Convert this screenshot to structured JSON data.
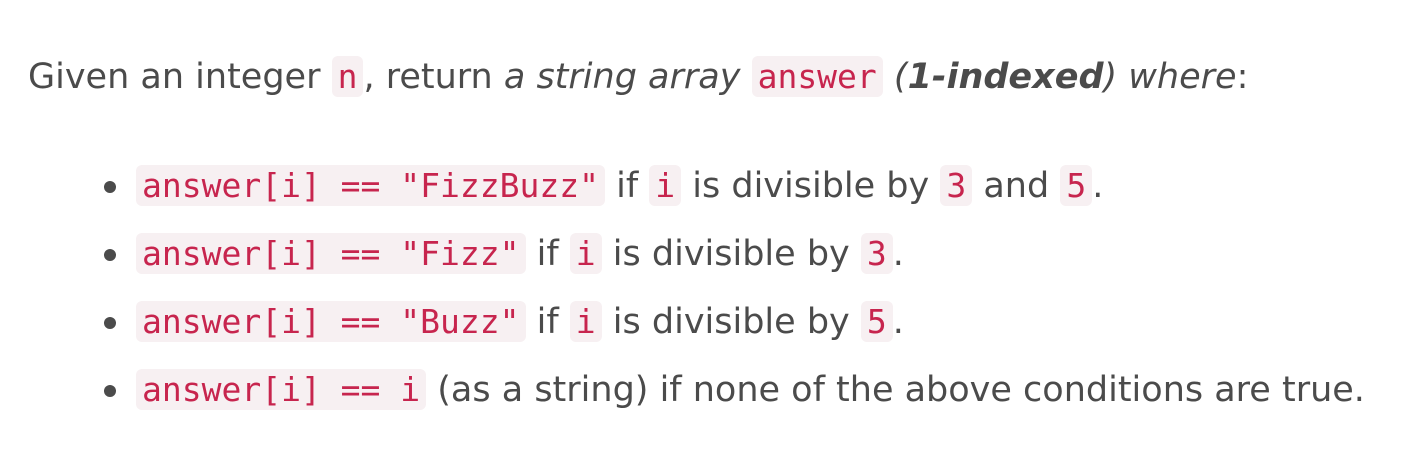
{
  "intro": {
    "given": "Given an integer ",
    "n": "n",
    "comma_return": ", return ",
    "string_array": "a string array",
    "space": " ",
    "answer": "answer",
    "open_paren": " (",
    "one_indexed": "1-indexed",
    "close_where": ") where",
    "colon": ":"
  },
  "conditions": [
    {
      "code": "answer[i] == \"FizzBuzz\"",
      "if": " if ",
      "i": "i",
      "div": " is divisible by ",
      "a": "3",
      "and": " and ",
      "b": "5",
      "end": "."
    },
    {
      "code": "answer[i] == \"Fizz\"",
      "if": " if ",
      "i": "i",
      "div": " is divisible by ",
      "a": "3",
      "end": "."
    },
    {
      "code": "answer[i] == \"Buzz\"",
      "if": " if ",
      "i": "i",
      "div": " is divisible by ",
      "a": "5",
      "end": "."
    },
    {
      "code": "answer[i] == i",
      "rest": " (as a string) if none of the above conditions are true."
    }
  ]
}
